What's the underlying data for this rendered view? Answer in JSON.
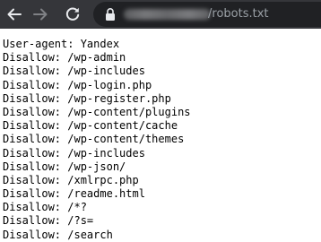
{
  "browser": {
    "address_bar": {
      "path": "/robots.txt"
    }
  },
  "document": {
    "lines": [
      "User-agent: Yandex",
      "Disallow: /wp-admin",
      "Disallow: /wp-includes",
      "Disallow: /wp-login.php",
      "Disallow: /wp-register.php",
      "Disallow: /wp-content/plugins",
      "Disallow: /wp-content/cache",
      "Disallow: /wp-content/themes",
      "Disallow: /wp-includes",
      "Disallow: /wp-json/",
      "Disallow: /xmlrpc.php",
      "Disallow: /readme.html",
      "Disallow: /*?",
      "Disallow: /?s=",
      "Disallow: /search"
    ]
  }
}
